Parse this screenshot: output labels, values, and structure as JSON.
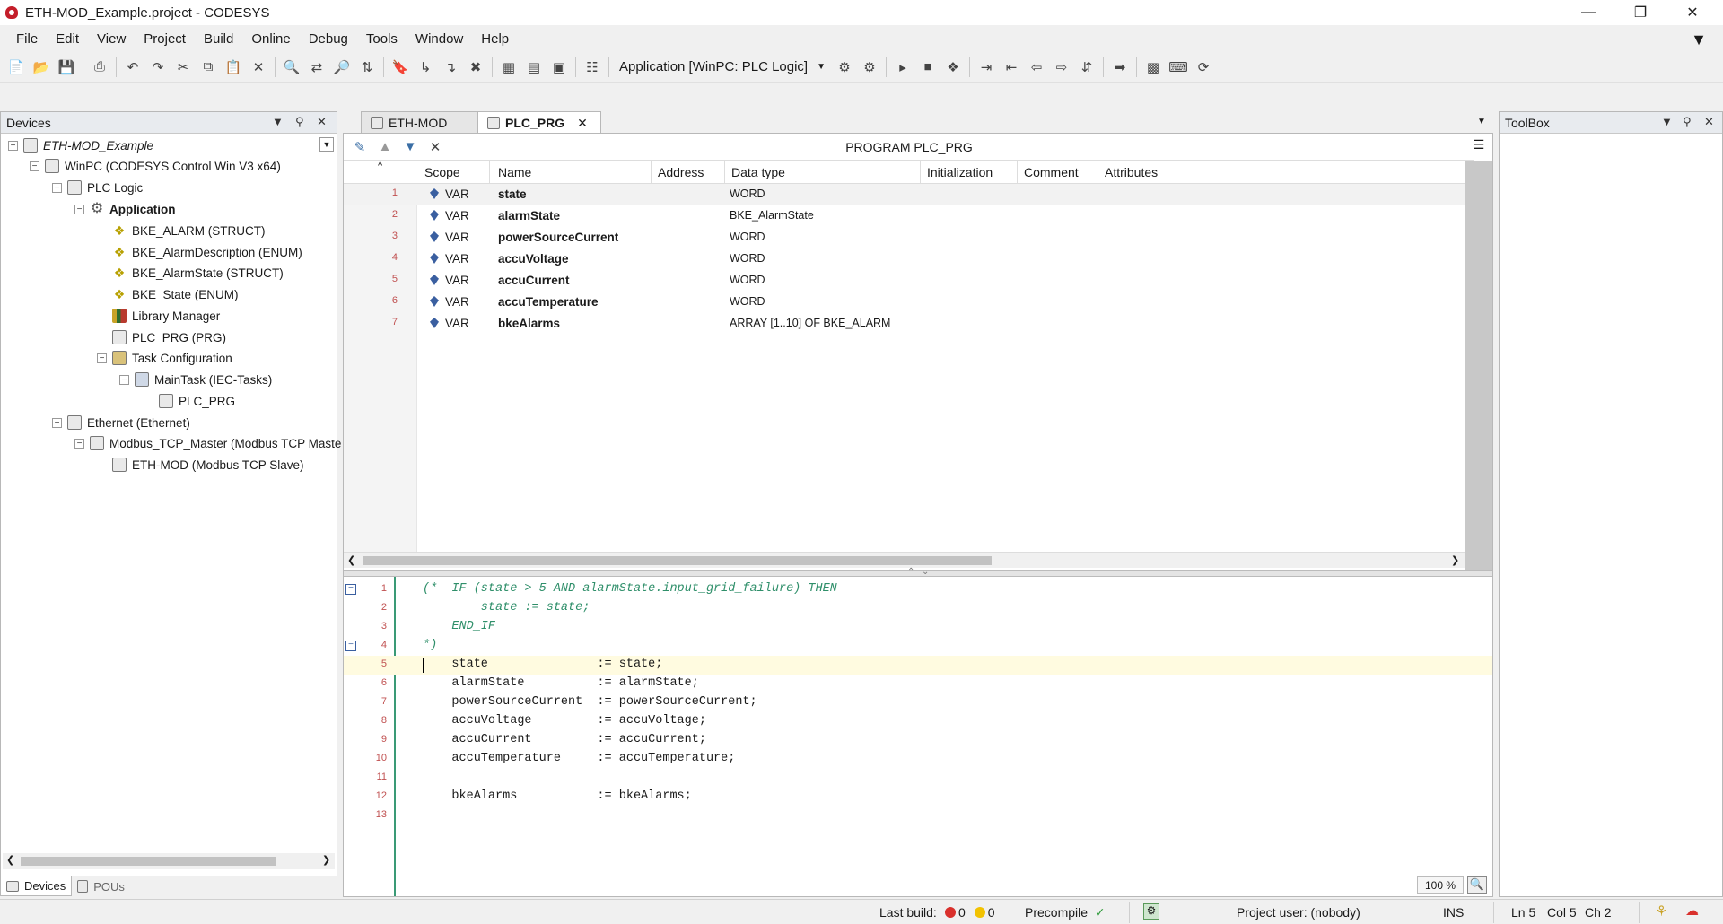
{
  "window": {
    "title": "ETH-MOD_Example.project - CODESYS",
    "minimize": "—",
    "restore": "❐",
    "close": "✕"
  },
  "menubar": [
    "File",
    "Edit",
    "View",
    "Project",
    "Build",
    "Online",
    "Debug",
    "Tools",
    "Window",
    "Help"
  ],
  "toolbar": {
    "app_selector": "Application [WinPC: PLC Logic]"
  },
  "devices_panel": {
    "title": "Devices",
    "tree": [
      {
        "label": "ETH-MOD_Example",
        "icon": "project-icon"
      },
      {
        "label": "WinPC (CODESYS Control Win V3 x64)",
        "icon": "device-icon"
      },
      {
        "label": "PLC Logic",
        "icon": "plc-icon"
      },
      {
        "label": "Application",
        "icon": "gear-icon"
      },
      {
        "label": "BKE_ALARM (STRUCT)",
        "icon": "struct-icon"
      },
      {
        "label": "BKE_AlarmDescription (ENUM)",
        "icon": "struct-icon"
      },
      {
        "label": "BKE_AlarmState (STRUCT)",
        "icon": "struct-icon"
      },
      {
        "label": "BKE_State (ENUM)",
        "icon": "struct-icon"
      },
      {
        "label": "Library Manager",
        "icon": "library-icon"
      },
      {
        "label": "PLC_PRG (PRG)",
        "icon": "program-icon"
      },
      {
        "label": "Task Configuration",
        "icon": "task-config-icon"
      },
      {
        "label": "MainTask (IEC-Tasks)",
        "icon": "task-icon"
      },
      {
        "label": "PLC_PRG",
        "icon": "program-call-icon"
      },
      {
        "label": "Ethernet (Ethernet)",
        "icon": "ethernet-icon"
      },
      {
        "label": "Modbus_TCP_Master (Modbus TCP Maste",
        "icon": "modbus-icon"
      },
      {
        "label": "ETH-MOD (Modbus TCP Slave)",
        "icon": "modbus-icon"
      }
    ],
    "tabs": [
      "Devices",
      "POUs"
    ]
  },
  "editor": {
    "tabs": [
      "ETH-MOD",
      "PLC_PRG"
    ],
    "program_title": "PROGRAM PLC_PRG",
    "columns": [
      "Scope",
      "Name",
      "Address",
      "Data type",
      "Initialization",
      "Comment",
      "Attributes"
    ],
    "declarations": [
      {
        "line": "1",
        "scope": "VAR",
        "name": "state",
        "type": "WORD"
      },
      {
        "line": "2",
        "scope": "VAR",
        "name": "alarmState",
        "type": "BKE_AlarmState"
      },
      {
        "line": "3",
        "scope": "VAR",
        "name": "powerSourceCurrent",
        "type": "WORD"
      },
      {
        "line": "4",
        "scope": "VAR",
        "name": "accuVoltage",
        "type": "WORD"
      },
      {
        "line": "5",
        "scope": "VAR",
        "name": "accuCurrent",
        "type": "WORD"
      },
      {
        "line": "6",
        "scope": "VAR",
        "name": "accuTemperature",
        "type": "WORD"
      },
      {
        "line": "7",
        "scope": "VAR",
        "name": "bkeAlarms",
        "type": "ARRAY [1..10] OF BKE_ALARM"
      }
    ],
    "code": [
      {
        "line": "1",
        "text": "(*  IF (state > 5 AND alarmState.input_grid_failure) THEN",
        "comment": true
      },
      {
        "line": "2",
        "text": "        state := state;",
        "comment": true
      },
      {
        "line": "3",
        "text": "    END_IF",
        "comment": true
      },
      {
        "line": "4",
        "text": "*)",
        "comment": true
      },
      {
        "line": "5",
        "text": "    state               := state;",
        "comment": false
      },
      {
        "line": "6",
        "text": "    alarmState          := alarmState;",
        "comment": false
      },
      {
        "line": "7",
        "text": "    powerSourceCurrent  := powerSourceCurrent;",
        "comment": false
      },
      {
        "line": "8",
        "text": "    accuVoltage         := accuVoltage;",
        "comment": false
      },
      {
        "line": "9",
        "text": "    accuCurrent         := accuCurrent;",
        "comment": false
      },
      {
        "line": "10",
        "text": "    accuTemperature     := accuTemperature;",
        "comment": false
      },
      {
        "line": "11",
        "text": "",
        "comment": false
      },
      {
        "line": "12",
        "text": "    bkeAlarms           := bkeAlarms;",
        "comment": false
      },
      {
        "line": "13",
        "text": "",
        "comment": false
      }
    ],
    "zoom": "100 %"
  },
  "toolbox_panel": {
    "title": "ToolBox"
  },
  "statusbar": {
    "last_build_label": "Last build:",
    "errors": "0",
    "warnings": "0",
    "precompile": "Precompile",
    "project_user": "Project user: (nobody)",
    "mode": "INS",
    "line": "Ln 5",
    "col": "Col 5",
    "ch": "Ch 2"
  },
  "colors": {
    "comment": "#2f8f6a",
    "line_number": "#c05050",
    "current_line": "#fffbe0",
    "panel_header": "#e8ebef"
  }
}
